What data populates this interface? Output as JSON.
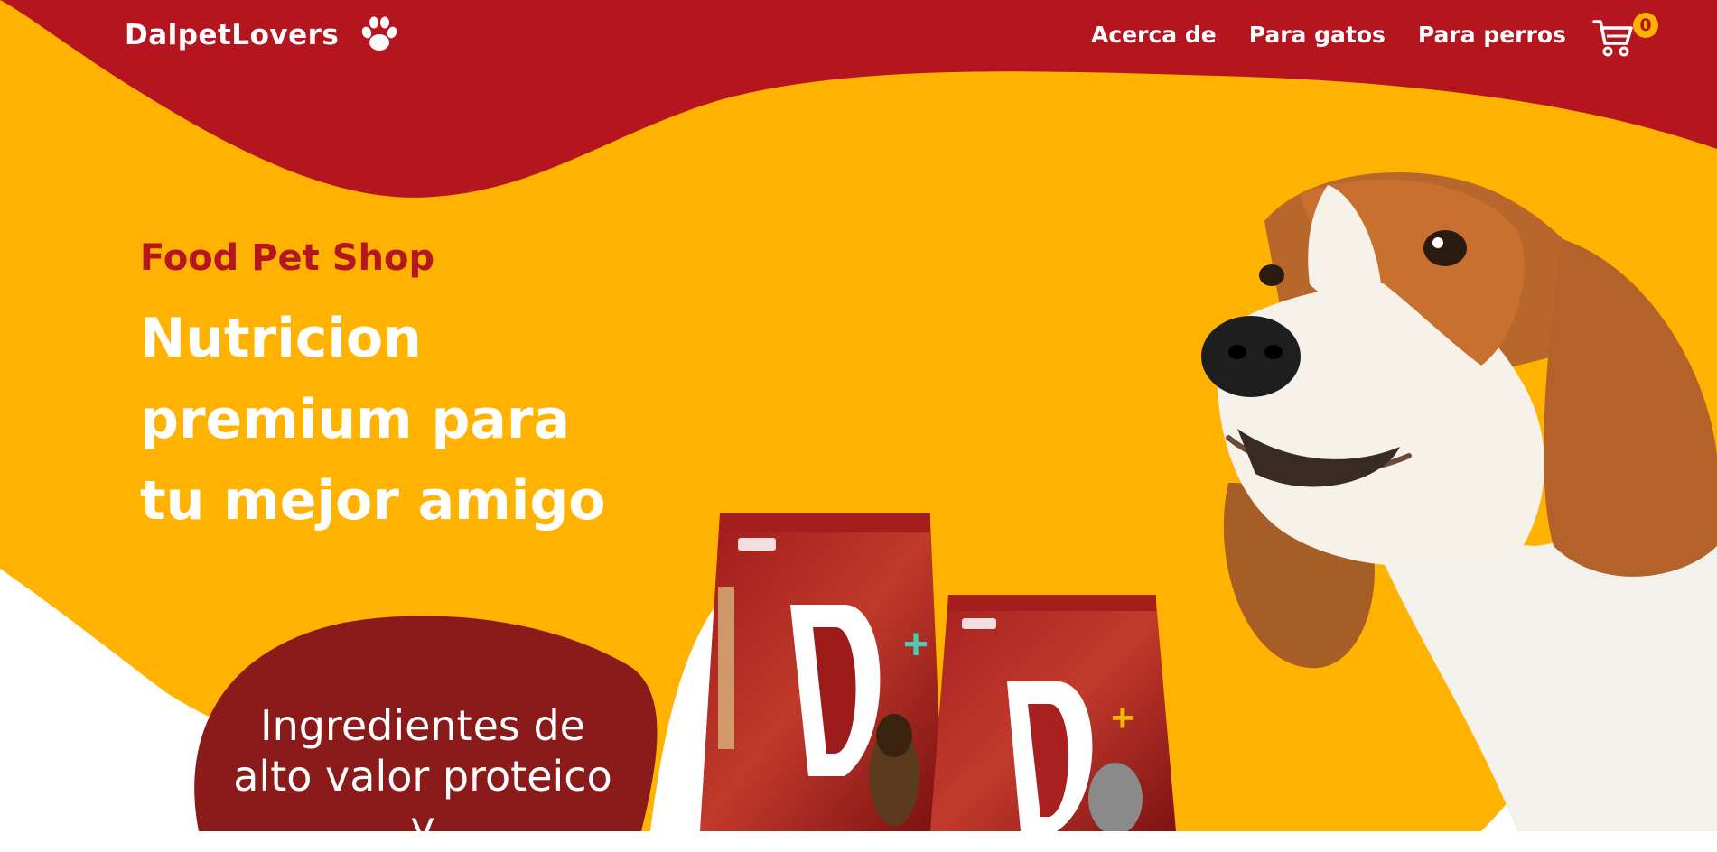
{
  "header": {
    "brand": "DalpetLovers",
    "brand_icon": "paw-icon",
    "nav": [
      {
        "label": "Acerca de"
      },
      {
        "label": "Para gatos"
      },
      {
        "label": "Para perros"
      }
    ],
    "cart_icon": "cart-icon",
    "cart_count": "0"
  },
  "hero": {
    "subtitle": "Food Pet Shop",
    "title": "Nutricion premium para tu mejor amigo",
    "blob_text": "Ingredientes de alto valor proteico y"
  },
  "colors": {
    "red": "#B5151F",
    "dark_red": "#8B1A1A",
    "yellow": "#FFB300",
    "white": "#FFFFFF"
  }
}
